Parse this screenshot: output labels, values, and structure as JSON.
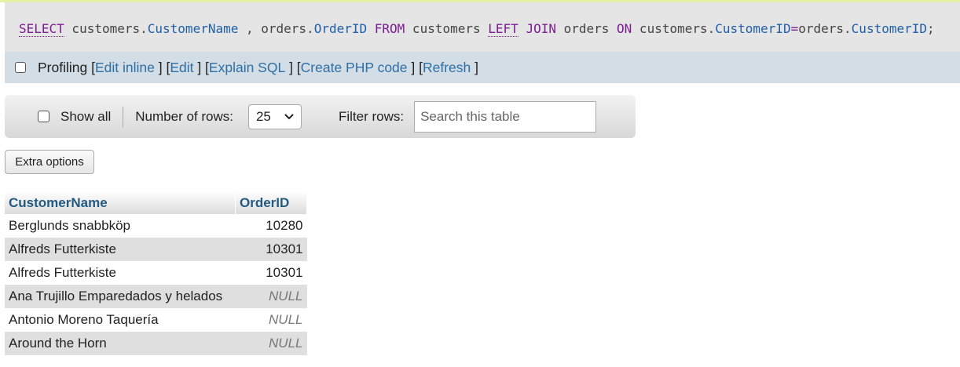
{
  "sql": {
    "tokens": [
      {
        "t": "SELECT",
        "c": "kw link"
      },
      {
        "t": " customers.",
        "c": ""
      },
      {
        "t": "CustomerName",
        "c": "fld"
      },
      {
        "t": " , orders.",
        "c": ""
      },
      {
        "t": "OrderID",
        "c": "fld"
      },
      {
        "t": " ",
        "c": ""
      },
      {
        "t": "FROM",
        "c": "kw"
      },
      {
        "t": " customers ",
        "c": ""
      },
      {
        "t": "LEFT",
        "c": "kw link"
      },
      {
        "t": " ",
        "c": ""
      },
      {
        "t": "JOIN",
        "c": "kw"
      },
      {
        "t": " orders ",
        "c": ""
      },
      {
        "t": "ON",
        "c": "kw"
      },
      {
        "t": " customers.",
        "c": ""
      },
      {
        "t": "CustomerID",
        "c": "fld"
      },
      {
        "t": "=",
        "c": "op"
      },
      {
        "t": "orders.",
        "c": ""
      },
      {
        "t": "CustomerID",
        "c": "fld"
      },
      {
        "t": ";",
        "c": ""
      }
    ]
  },
  "profiling": {
    "label": "Profiling",
    "links": [
      "Edit inline",
      "Edit",
      "Explain SQL",
      "Create PHP code",
      "Refresh"
    ]
  },
  "controls": {
    "show_all": "Show all",
    "rows_label": "Number of rows:",
    "rows_value": "25",
    "filter_label": "Filter rows:",
    "search_placeholder": "Search this table"
  },
  "extra_options": "Extra options",
  "table": {
    "columns": [
      "CustomerName",
      "OrderID"
    ],
    "rows": [
      [
        "Berglunds snabbköp",
        "10280"
      ],
      [
        "Alfreds Futterkiste",
        "10301"
      ],
      [
        "Alfreds Futterkiste",
        "10301"
      ],
      [
        "Ana Trujillo Emparedados y helados",
        "NULL"
      ],
      [
        "Antonio Moreno Taquería",
        "NULL"
      ],
      [
        "Around the Horn",
        "NULL"
      ]
    ]
  }
}
